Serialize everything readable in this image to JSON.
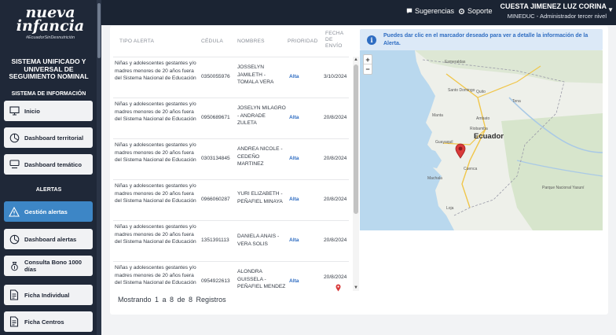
{
  "topbar": {
    "suggestions": "Sugerencias",
    "support": "Soporte",
    "user_name": "CUESTA JIMENEZ LUZ CORINA",
    "user_role": "MINEDUC - Administrador tercer nivel"
  },
  "sidebar": {
    "logo_word_1": "nueva",
    "logo_word_2": "infancia",
    "logo_tagline": "#EcuadorSinDesnutrición",
    "system_title": "SISTEMA UNIFICADO Y UNIVERSAL DE SEGUIMIENTO NOMINAL",
    "section_info": "SISTEMA DE INFORMACIÓN",
    "section_alerts": "ALERTAS",
    "items": [
      {
        "label": "Inicio",
        "icon": "monitor-icon"
      },
      {
        "label": "Dashboard territorial",
        "icon": "pie-chart-icon"
      },
      {
        "label": "Dashboard temático",
        "icon": "display-icon"
      },
      {
        "label": "Gestión alertas",
        "icon": "alert-triangle-icon",
        "active": true
      },
      {
        "label": "Dashboard alertas",
        "icon": "pie-chart-icon"
      },
      {
        "label": "Consulta Bono 1000 días",
        "icon": "money-bag-icon"
      },
      {
        "label": "Ficha Individual",
        "icon": "document-icon"
      },
      {
        "label": "Ficha Centros",
        "icon": "document-icon"
      }
    ]
  },
  "table": {
    "headers": {
      "type": "TIPO ALERTA",
      "id": "CÉDULA",
      "names": "NOMBRES",
      "priority": "PRIORIDAD",
      "date": "FECHA DE ENVÍO"
    },
    "rows": [
      {
        "type": "Niñas y adolescentes gestantes y/o madres menores de 20 años fuera del Sistema Nacional de Educación",
        "id": "0350055976",
        "names": "JOSSELYN JAMILETH - TOMALA VERA",
        "priority": "Alta",
        "date": "3/10/2024"
      },
      {
        "type": "Niñas y adolescentes gestantes y/o madres menores de 20 años fuera del Sistema Nacional de Educación",
        "id": "0950689671",
        "names": "JOSELYN MILAGRO - ANDRADE ZULETA",
        "priority": "Alta",
        "date": "20/8/2024"
      },
      {
        "type": "Niñas y adolescentes gestantes y/o madres menores de 20 años fuera del Sistema Nacional de Educación",
        "id": "0303134845",
        "names": "ANDREA NICOLE - CEDEÑO MARTINEZ",
        "priority": "Alta",
        "date": "20/8/2024"
      },
      {
        "type": "Niñas y adolescentes gestantes y/o madres menores de 20 años fuera del Sistema Nacional de Educación",
        "id": "0966060287",
        "names": "YURI ELIZABETH - PEÑAFIEL MINAYA",
        "priority": "Alta",
        "date": "20/8/2024"
      },
      {
        "type": "Niñas y adolescentes gestantes y/o madres menores de 20 años fuera del Sistema Nacional de Educación",
        "id": "1351391113",
        "names": "DANIELA ANAIS - VERA SOLIS",
        "priority": "Alta",
        "date": "20/8/2024"
      },
      {
        "type": "Niñas y adolescentes gestantes y/o madres menores de 20 años fuera del Sistema Nacional de Educación",
        "id": "0954922613",
        "names": "ALONDRA GUISSELA - PEÑAFIEL MENDEZ",
        "priority": "Alta",
        "date": "20/8/2024"
      }
    ],
    "footer": "Mostrando 1 a 8 de 8 Registros"
  },
  "info": {
    "text": "Puedes dar clic en el marcador deseado para ver a detalle la información de la Alerta."
  },
  "map": {
    "country_label": "Ecuador",
    "city_labels": [
      "Esmeraldas",
      "Santo Domingo",
      "Quito",
      "Manta",
      "Ambato",
      "Riobamba",
      "Guayaquil",
      "Cuenca",
      "Machala",
      "Loja",
      "Tena",
      "Parque Nacional Yasuní"
    ],
    "zoom_in": "+",
    "zoom_out": "−"
  }
}
